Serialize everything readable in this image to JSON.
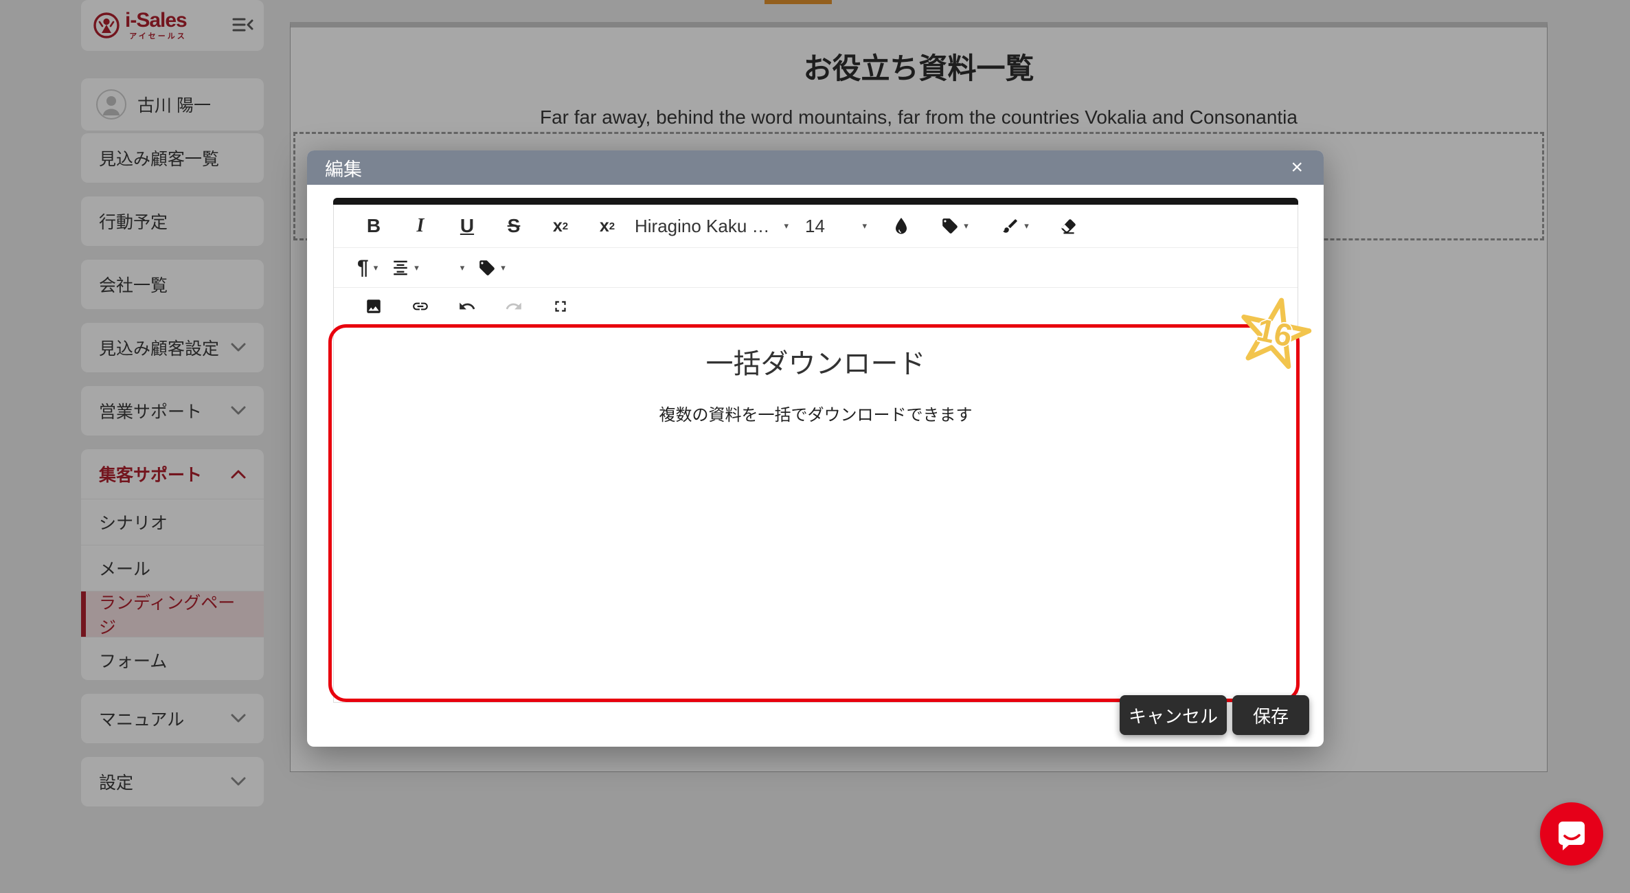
{
  "brand": {
    "logo_text": "i-Sales",
    "logo_subtitle": "アイセールス",
    "brand_red": "#b0212e"
  },
  "sidebar": {
    "user_name": "古川 陽一",
    "items": [
      {
        "label": "見込み顧客一覧"
      },
      {
        "label": "行動予定"
      },
      {
        "label": "会社一覧"
      },
      {
        "label": "見込み顧客設定"
      },
      {
        "label": "営業サポート"
      },
      {
        "label": "集客サポート",
        "children": [
          "シナリオ",
          "メール",
          "ランディングページ",
          "フォーム"
        ],
        "active_child": "ランディングページ"
      },
      {
        "label": "マニュアル"
      },
      {
        "label": "設定"
      }
    ]
  },
  "page": {
    "title": "お役立ち資料一覧",
    "subtitle": "Far far away, behind the word mountains, far from the countries Vokalia and Consonantia"
  },
  "modal": {
    "title": "編集",
    "close_label": "×",
    "toolbar": {
      "bold": "B",
      "italic": "I",
      "underline": "U",
      "strikethrough": "S",
      "script_base": "x",
      "subscript_digit": "2",
      "superscript_digit": "2",
      "font_family_value": "Hiragino Kaku …",
      "font_size_value": "14",
      "paragraph": "¶",
      "caret": "▾"
    },
    "editor": {
      "heading": "一括ダウンロード",
      "body": "複数の資料を一括でダウンロードできます"
    },
    "cancel_label": "キャンセル",
    "save_label": "保存"
  },
  "annotation": {
    "badge_number": "16",
    "box_color": "#e8000d",
    "star_color": "#f2c44d"
  },
  "colors": {
    "modal_header": "#7b8492",
    "chat_red": "#e60019"
  }
}
